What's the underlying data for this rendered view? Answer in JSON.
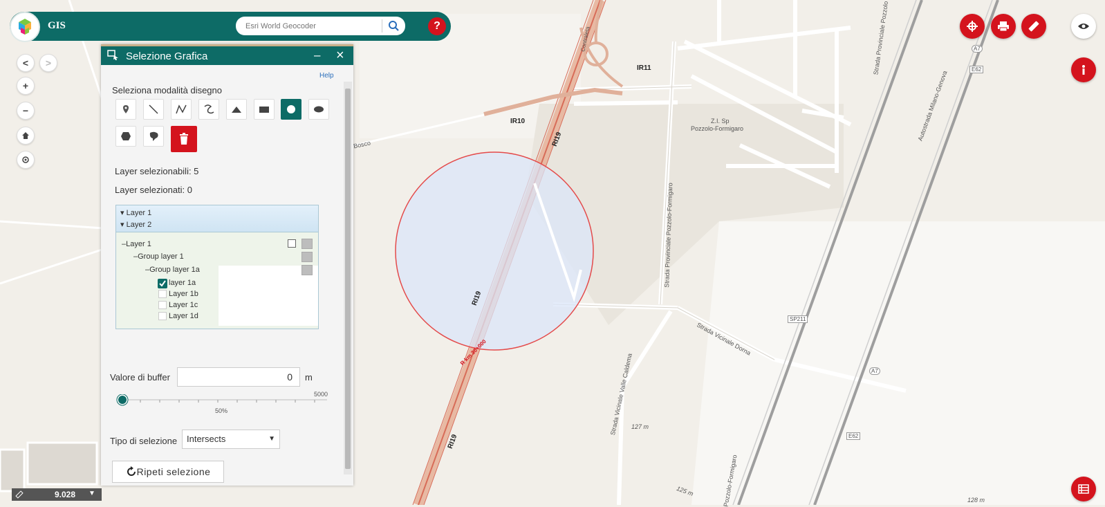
{
  "header": {
    "title": "GIS",
    "search_placeholder": "Esri World Geocoder",
    "help_label": "?"
  },
  "map_labels": {
    "ir11": "IR11",
    "ir10": "IR10",
    "ri19_a": "RI19",
    "ri19_b": "RI19",
    "ri19_c": "RI19",
    "zi": "Z.I. Sp",
    "pozzolo": "Pozzolo-Formigaro",
    "strada_prov": "Strada Provinciale Pozzolo-Formigaro",
    "strada_dorna": "Strada Vicinale Dorna",
    "strada_valle": "Strada Vicinale Valle Caldema",
    "bosco": "Bosco",
    "sp211": "SP211",
    "a7_a": "A7",
    "a7_b": "A7",
    "e62_a": "E62",
    "e62_b": "E62",
    "autostrada": "Autostrada Milano-Genova",
    "strada_prov_top": "Strada Provinciale Pozzolo",
    "elev_127": "127 m",
    "elev_125": "125 m",
    "elev_128": "128 m",
    "pozzolo_bottom": "Pozzolo-Formigaro",
    "km_marker": "R km 30+000",
    "contraleta": "Contraleta"
  },
  "panel": {
    "title": "Selezione Grafica",
    "help": "Help",
    "draw_mode_label": "Seleziona modalità disegno",
    "selectable_layers": "Layer selezionabili: 5",
    "selected_layers": "Layer selezionati: 0",
    "tree_head": [
      "Layer 1",
      "Layer 2"
    ],
    "tree": {
      "layer1": "Layer 1",
      "group1": "Group layer 1",
      "group1a": "Group layer 1a",
      "layer1a": "layer 1a",
      "layer1b": "Layer 1b",
      "layer1c": "Layer 1c",
      "layer1d": "Layer 1d"
    },
    "buffer_label": "Valore di buffer",
    "buffer_value": "0",
    "buffer_unit": "m",
    "slider_max": "5000",
    "slider_mid": "50%",
    "selection_type_label": "Tipo di selezione",
    "selection_type_value": "Intersects",
    "repeat_label": "Ripeti selezione"
  },
  "scale": {
    "value": "9.028"
  },
  "colors": {
    "header": "#0d6b66",
    "accent_red": "#d4131d"
  }
}
